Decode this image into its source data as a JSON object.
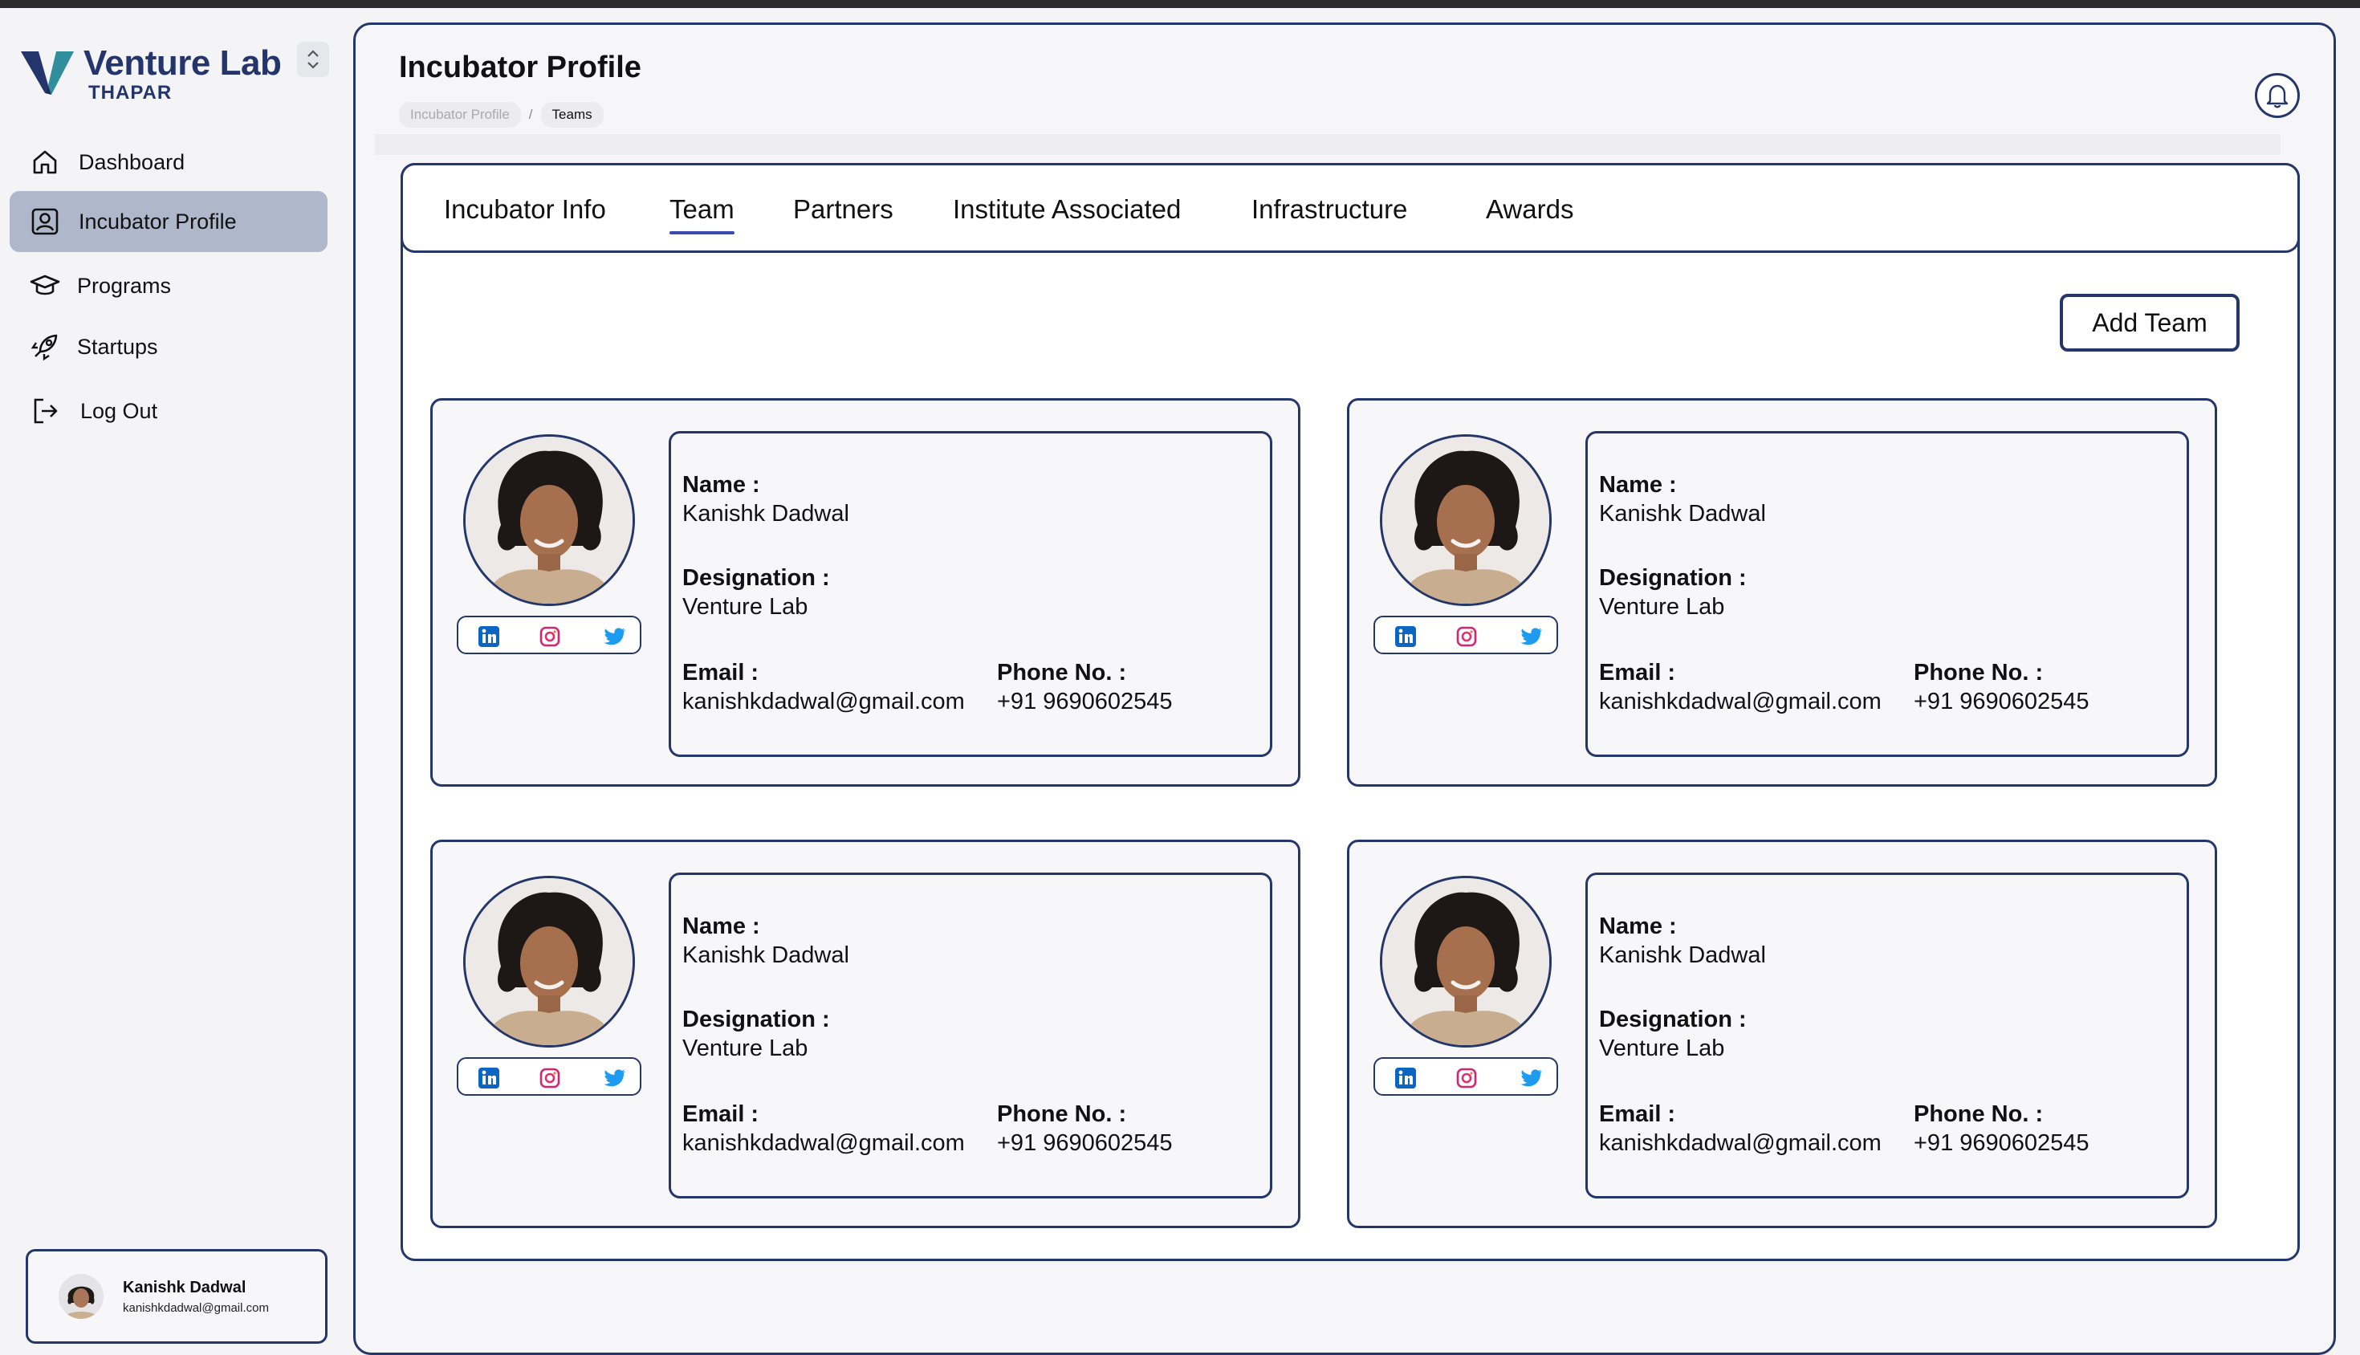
{
  "brand": {
    "name": "Venture Lab",
    "sub": "THAPAR",
    "color": "#23356b"
  },
  "sidebar": {
    "items": [
      {
        "label": "Dashboard",
        "icon": "home-icon",
        "active": false
      },
      {
        "label": "Incubator Profile",
        "icon": "user-card-icon",
        "active": true
      },
      {
        "label": "Programs",
        "icon": "graduation-cap-icon",
        "active": false
      },
      {
        "label": "Startups",
        "icon": "rocket-icon",
        "active": false
      },
      {
        "label": "Log Out",
        "icon": "logout-icon",
        "active": false
      }
    ],
    "user": {
      "name": "Kanishk Dadwal",
      "email": "kanishkdadwal@gmail.com"
    }
  },
  "header": {
    "title": "Incubator Profile",
    "breadcrumbs": [
      "Incubator Profile",
      "Teams"
    ],
    "breadcrumb_sep": "/"
  },
  "tabs": [
    {
      "label": "Incubator Info",
      "active": false
    },
    {
      "label": "Team",
      "active": true
    },
    {
      "label": "Partners",
      "active": false
    },
    {
      "label": "Institute Associated",
      "active": false
    },
    {
      "label": "Infrastructure",
      "active": false
    },
    {
      "label": "Awards",
      "active": false
    }
  ],
  "actions": {
    "add_team": "Add Team"
  },
  "labels": {
    "name": "Name :",
    "designation": "Designation :",
    "email": "Email :",
    "phone": "Phone No. :"
  },
  "team": [
    {
      "name": "Kanishk Dadwal",
      "designation": "Venture Lab",
      "email": "kanishkdadwal@gmail.com",
      "phone": "+91 9690602545"
    },
    {
      "name": "Kanishk Dadwal",
      "designation": "Venture Lab",
      "email": "kanishkdadwal@gmail.com",
      "phone": "+91 9690602545"
    },
    {
      "name": "Kanishk Dadwal",
      "designation": "Venture Lab",
      "email": "kanishkdadwal@gmail.com",
      "phone": "+91 9690602545"
    },
    {
      "name": "Kanishk Dadwal",
      "designation": "Venture Lab",
      "email": "kanishkdadwal@gmail.com",
      "phone": "+91 9690602545"
    }
  ],
  "social_icons": [
    "linkedin-icon",
    "instagram-icon",
    "twitter-icon"
  ],
  "colors": {
    "accent": "#25366a",
    "active_nav": "#aeb8ca",
    "tab_underline": "#3a4bb0",
    "linkedin": "#0a66c2",
    "twitter": "#1d9bf0"
  }
}
